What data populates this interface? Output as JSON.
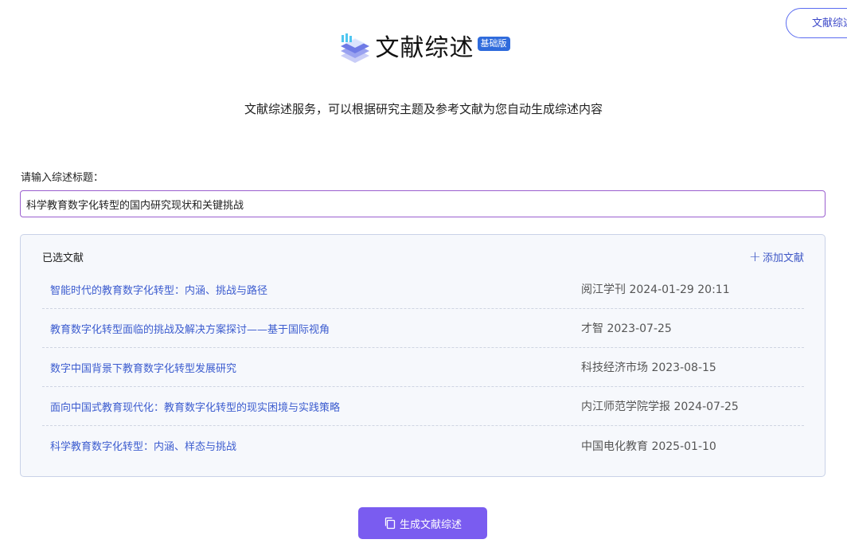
{
  "top_right_button": {
    "label": "文献综述"
  },
  "header": {
    "title": "文献综述",
    "badge": "基础版"
  },
  "subtitle": "文献综述服务，可以根据研究主题及参考文献为您自动生成综述内容",
  "input": {
    "label": "请输入综述标题：",
    "value": "科学教育数字化转型的国内研究现状和关键挑战"
  },
  "references": {
    "title": "已选文献",
    "add_label": "添加文献",
    "items": [
      {
        "title": "智能时代的教育数字化转型：内涵、挑战与路径",
        "meta": "阅江学刊 2024-01-29 20:11"
      },
      {
        "title": "教育数字化转型面临的挑战及解决方案探讨——基于国际视角",
        "meta": "才智 2023-07-25"
      },
      {
        "title": "数字中国背景下教育数字化转型发展研究",
        "meta": "科技经济市场 2023-08-15"
      },
      {
        "title": "面向中国式教育现代化：教育数字化转型的现实困境与实践策略",
        "meta": "内江师范学院学报 2024-07-25"
      },
      {
        "title": "科学教育数字化转型：内涵、样态与挑战",
        "meta": "中国电化教育 2025-01-10"
      }
    ]
  },
  "generate_button": {
    "label": "生成文献综述"
  },
  "colors": {
    "accent": "#7a5cf0",
    "link": "#3c5ccf",
    "badge": "#2f6bdc"
  }
}
